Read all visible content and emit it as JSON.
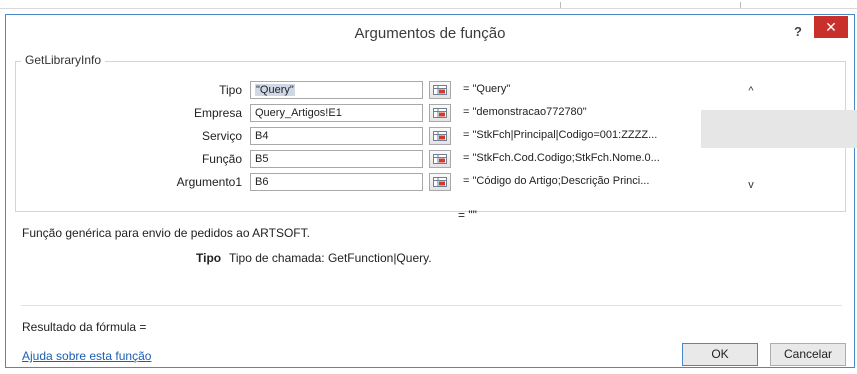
{
  "dialog": {
    "title": "Argumentos de função",
    "help_label": "?",
    "close_label": "✕"
  },
  "group": {
    "legend": "GetLibraryInfo"
  },
  "args": [
    {
      "label": "Tipo",
      "input": "\"Query\"",
      "value": "= \"Query\""
    },
    {
      "label": "Empresa",
      "input": "Query_Artigos!E1",
      "value": "= \"demonstracao772780\""
    },
    {
      "label": "Serviço",
      "input": "B4",
      "value": "= \"StkFch|Principal|Codigo=001:ZZZZ..."
    },
    {
      "label": "Função",
      "input": "B5",
      "value": "= \"StkFch.Cod.Codigo;StkFch.Nome.0..."
    },
    {
      "label": "Argumento1",
      "input": "B6",
      "value": "= \"Código do Artigo;Descrição Princi..."
    }
  ],
  "scroll": {
    "up": "^",
    "down": "v"
  },
  "result_value": "= \"\"",
  "description": "Função genérica para envio de pedidos ao ARTSOFT.",
  "param_help": {
    "name": "Tipo",
    "text": "Tipo de chamada: GetFunction|Query."
  },
  "formula_result_label": "Resultado da fórmula =",
  "help_link": "Ajuda sobre esta função",
  "buttons": {
    "ok": "OK",
    "cancel": "Cancelar"
  }
}
